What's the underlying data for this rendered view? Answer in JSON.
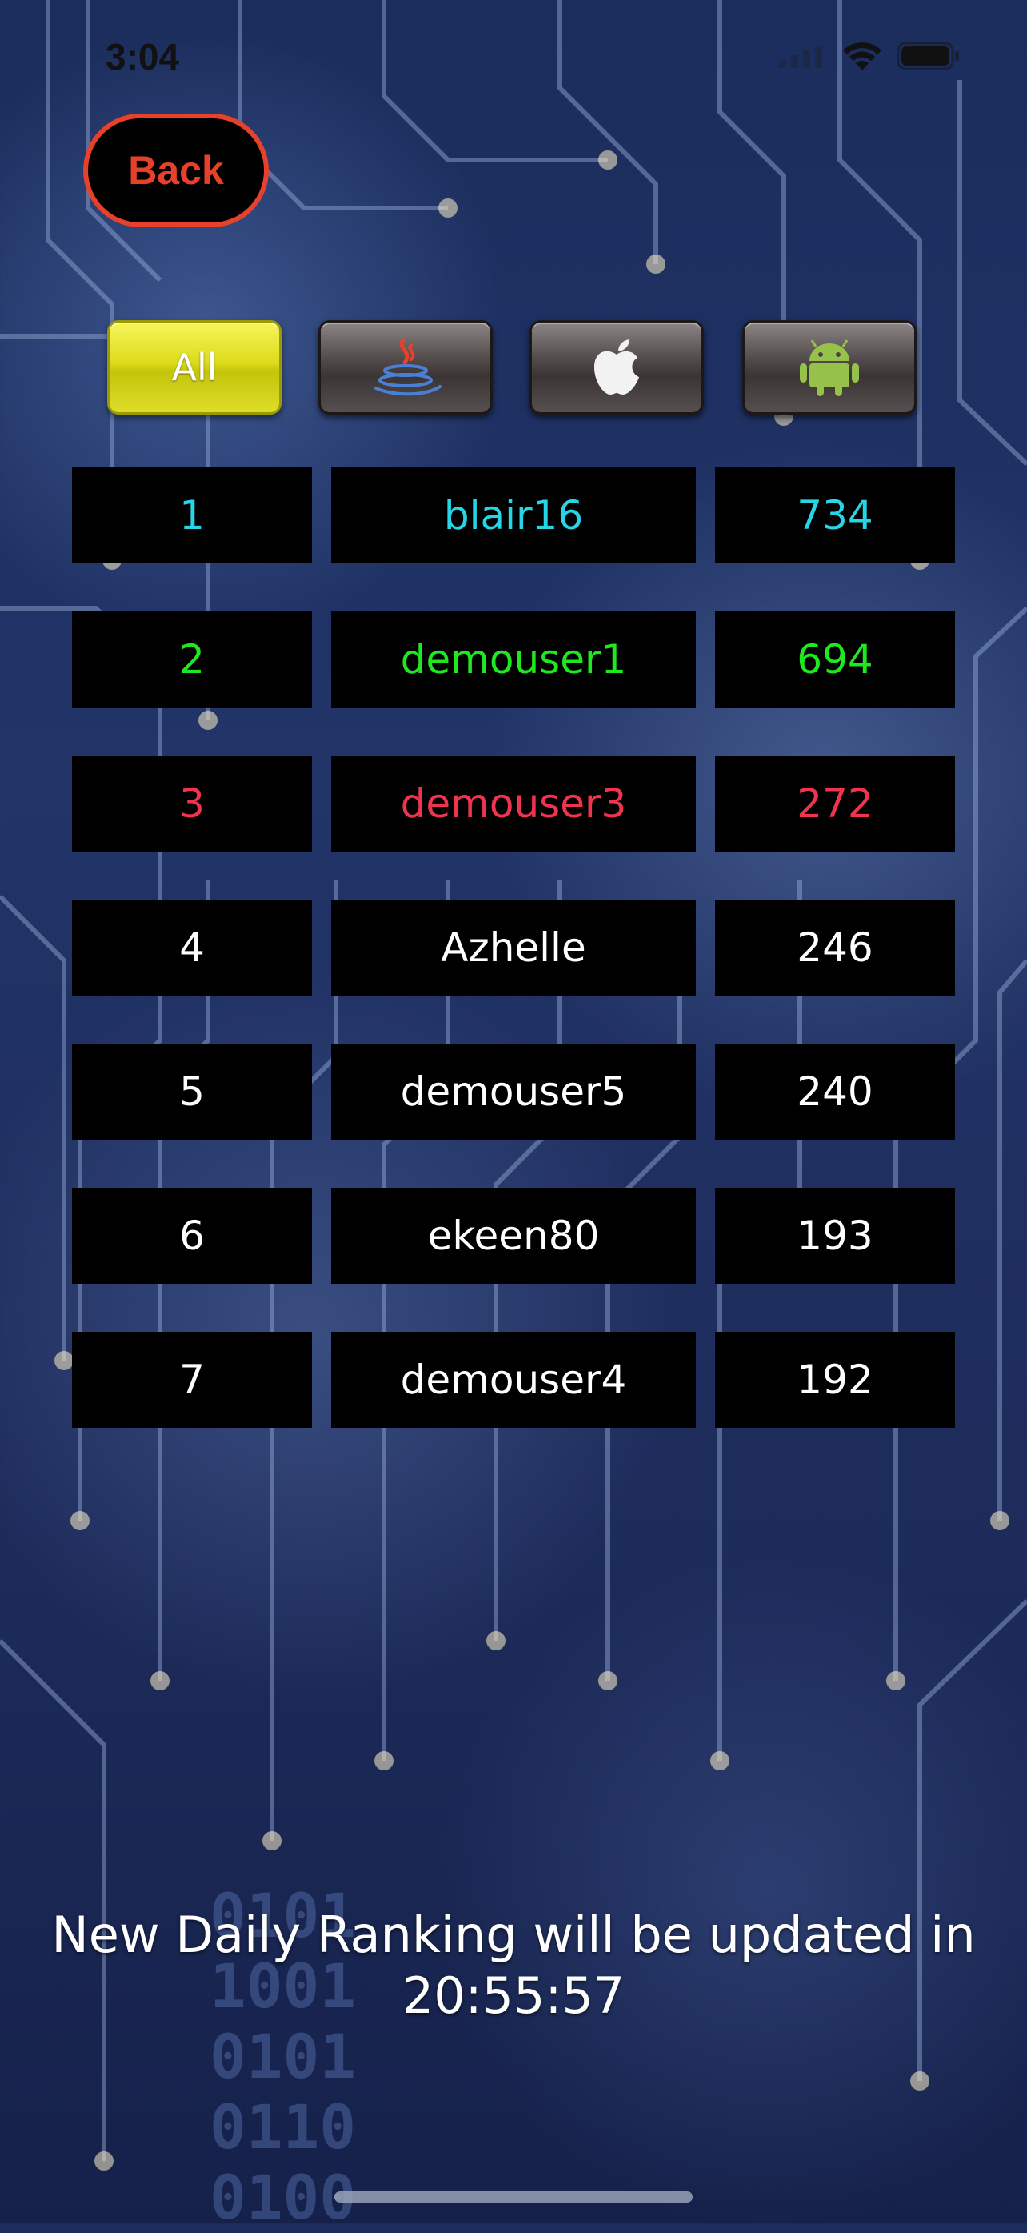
{
  "status_bar": {
    "time": "3:04"
  },
  "back_button": {
    "label": "Back"
  },
  "filters": [
    {
      "label": "All",
      "icon": "",
      "active": true
    },
    {
      "label": "",
      "icon": "java-icon",
      "active": false
    },
    {
      "label": "",
      "icon": "apple-icon",
      "active": false
    },
    {
      "label": "",
      "icon": "android-icon",
      "active": false
    }
  ],
  "ranking": [
    {
      "rank": "1",
      "name": "blair16",
      "score": "734",
      "color": "#27d6e6"
    },
    {
      "rank": "2",
      "name": "demouser1",
      "score": "694",
      "color": "#1ee81e"
    },
    {
      "rank": "3",
      "name": "demouser3",
      "score": "272",
      "color": "#f0344f"
    },
    {
      "rank": "4",
      "name": "Azhelle",
      "score": "246",
      "color": "#ffffff"
    },
    {
      "rank": "5",
      "name": "demouser5",
      "score": "240",
      "color": "#ffffff"
    },
    {
      "rank": "6",
      "name": "ekeen80",
      "score": "193",
      "color": "#ffffff"
    },
    {
      "rank": "7",
      "name": "demouser4",
      "score": "192",
      "color": "#ffffff"
    }
  ],
  "countdown": {
    "message": "New Daily Ranking will be updated in",
    "time": "20:55:57"
  },
  "background_binary": [
    "0101",
    "1001",
    "0101",
    "0110",
    "0100"
  ],
  "colors": {
    "accent": "#e8412b",
    "active_filter": "#dcdb1b"
  }
}
